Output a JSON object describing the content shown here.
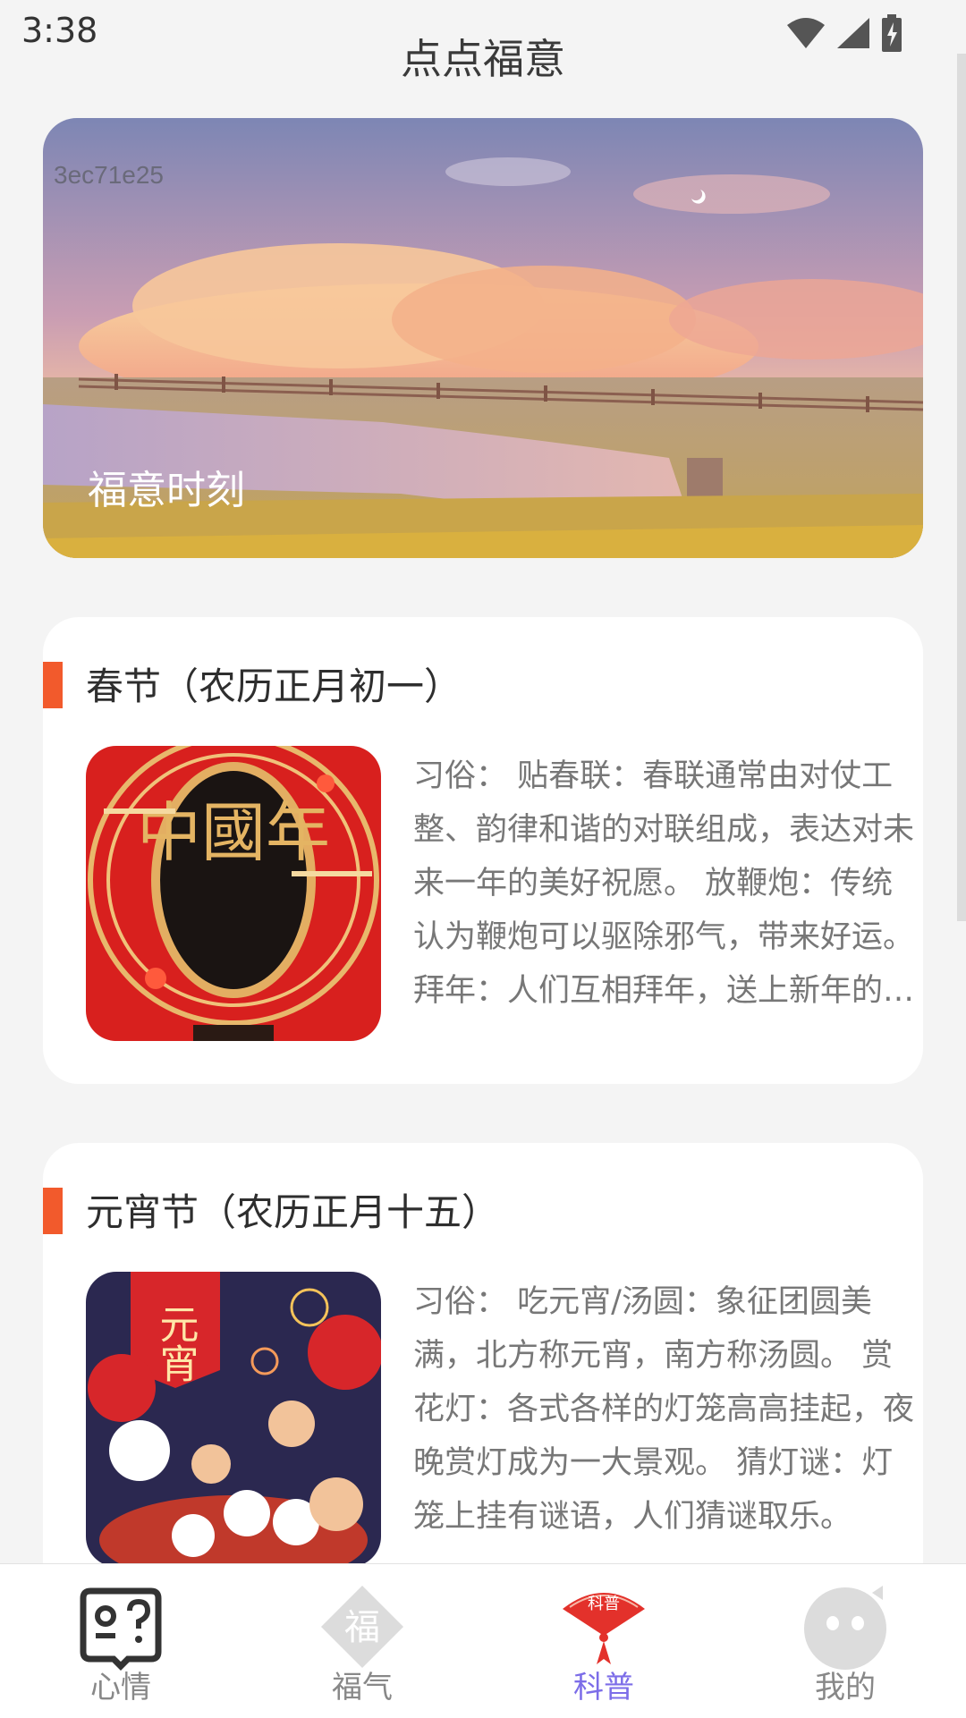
{
  "status_bar": {
    "time": "3:38"
  },
  "app": {
    "title": "点点福意"
  },
  "banner": {
    "code": "3ec71e25",
    "caption": "福意时刻"
  },
  "cards": [
    {
      "title": "春节（农历正月初一）",
      "image_text": "中國年",
      "description": "习俗： 贴春联：春联通常由对仗工整、韵律和谐的对联组成，表达对未来一年的美好祝愿。 放鞭炮：传统认为鞭炮可以驱除邪气，带来好运。 拜年：人们互相拜年，送上新年的祝福。"
    },
    {
      "title": "元宵节（农历正月十五）",
      "image_text": "元宵",
      "description": "习俗： 吃元宵/汤圆：象征团圆美满，北方称元宵，南方称汤圆。 赏花灯：各式各样的灯笼高高挂起，夜晚赏灯成为一大景观。 猜灯谜：灯笼上挂有谜语，人们猜谜取乐。"
    }
  ],
  "tabs": [
    {
      "label": "心情",
      "icon": "mood-book-icon",
      "active": false
    },
    {
      "label": "福气",
      "icon": "fu-diamond-icon",
      "icon_text": "福",
      "active": false
    },
    {
      "label": "科普",
      "icon": "fan-science-icon",
      "icon_text": "科普",
      "active": true
    },
    {
      "label": "我的",
      "icon": "profile-face-icon",
      "active": false
    }
  ],
  "colors": {
    "accent": "#f25a2c",
    "active_tab": "#7c6de8",
    "festival_red": "#d8201e"
  }
}
